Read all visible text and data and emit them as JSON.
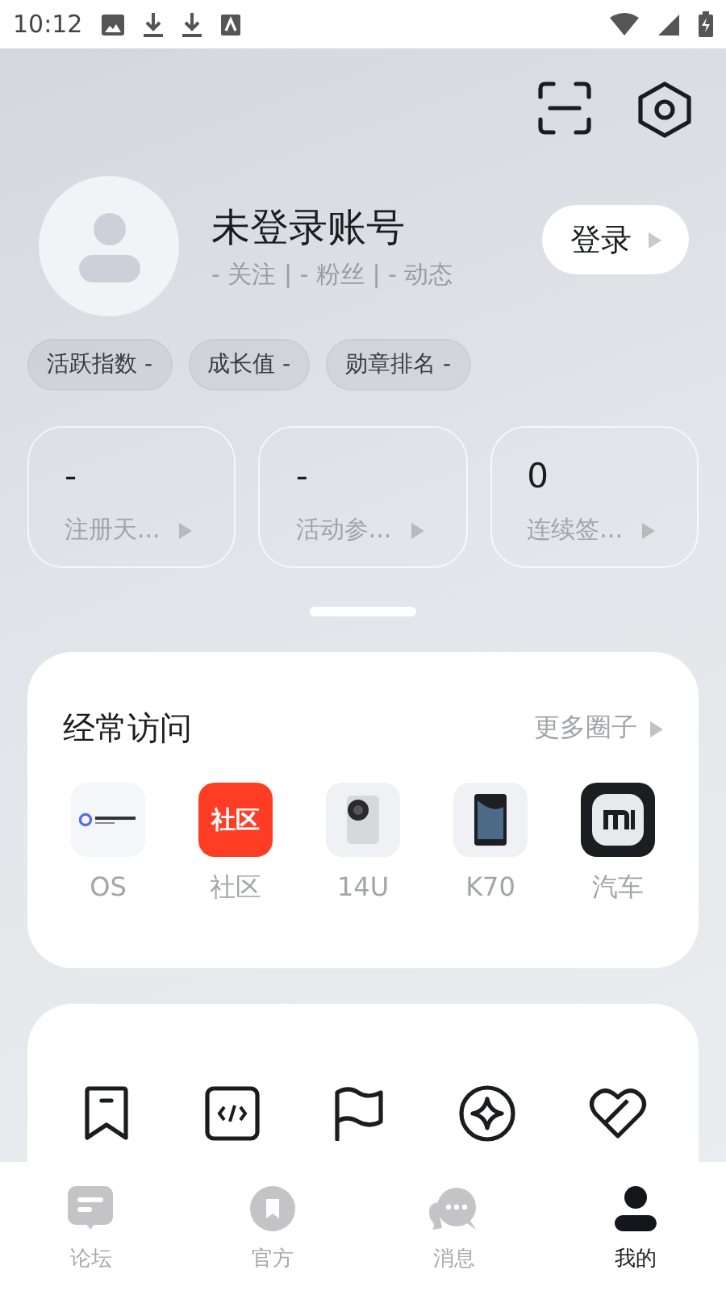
{
  "status_bar": {
    "time": "10:12"
  },
  "profile": {
    "name": "未登录账号",
    "follow_line": "- 关注 | - 粉丝 | - 动态",
    "login_button": "登录"
  },
  "chips": [
    "活跃指数 -",
    "成长值 -",
    "勋章排名 -"
  ],
  "stats": [
    {
      "value": "-",
      "label": "注册天..."
    },
    {
      "value": "-",
      "label": "活动参..."
    },
    {
      "value": "0",
      "label": "连续签..."
    }
  ],
  "frequent": {
    "title": "经常访问",
    "more": "更多圈子",
    "items": [
      {
        "kind": "os",
        "label": "OS"
      },
      {
        "kind": "community",
        "label": "社区",
        "logo_text": "社区"
      },
      {
        "kind": "phone-light",
        "label": "14U"
      },
      {
        "kind": "phone-dark",
        "label": "K70"
      },
      {
        "kind": "car",
        "label": "汽车"
      }
    ]
  },
  "tools": [
    {
      "kind": "bookmark"
    },
    {
      "kind": "code"
    },
    {
      "kind": "flag"
    },
    {
      "kind": "sparkle"
    },
    {
      "kind": "heart"
    }
  ],
  "bottom_nav": [
    {
      "kind": "forum",
      "label": "论坛",
      "selected": false
    },
    {
      "kind": "official",
      "label": "官方",
      "selected": false
    },
    {
      "kind": "messages",
      "label": "消息",
      "selected": false
    },
    {
      "kind": "me",
      "label": "我的",
      "selected": true
    }
  ]
}
